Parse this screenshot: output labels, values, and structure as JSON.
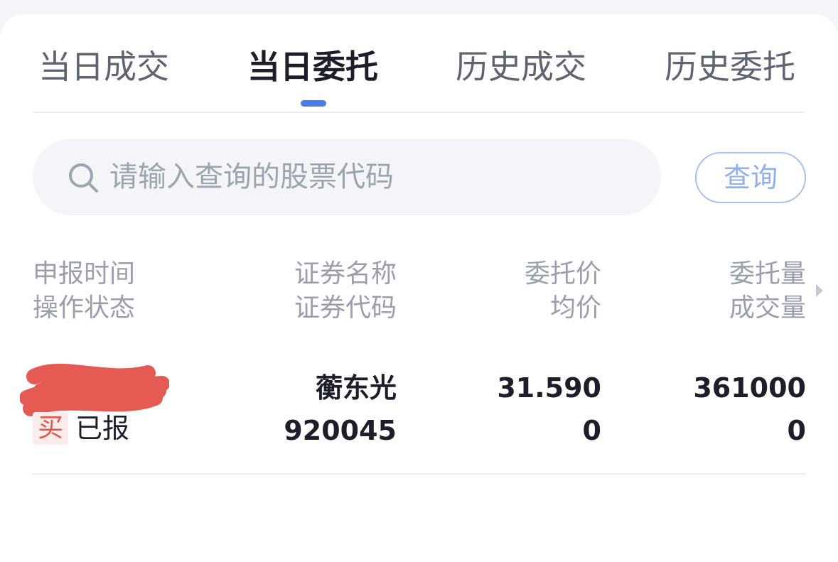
{
  "tabs": [
    {
      "label": "当日成交",
      "active": false
    },
    {
      "label": "当日委托",
      "active": true
    },
    {
      "label": "历史成交",
      "active": false
    },
    {
      "label": "历史委托",
      "active": false
    }
  ],
  "search": {
    "placeholder": "请输入查询的股票代码",
    "value": "",
    "button_label": "查询"
  },
  "columns": {
    "col1": {
      "line1": "申报时间",
      "line2": "操作状态"
    },
    "col2": {
      "line1": "证券名称",
      "line2": "证券代码"
    },
    "col3": {
      "line1": "委托价",
      "line2": "均价"
    },
    "col4": {
      "line1": "委托量",
      "line2": "成交量"
    }
  },
  "orders": [
    {
      "side": "买",
      "status": "已报",
      "security_name": "蘅东光",
      "security_code": "920045",
      "order_price": "31.590",
      "avg_price": "0",
      "order_qty": "361000",
      "filled_qty": "0"
    }
  ],
  "colors": {
    "accent": "#4a7bea",
    "buy": "#e4574a",
    "redaction": "#e55a53"
  }
}
